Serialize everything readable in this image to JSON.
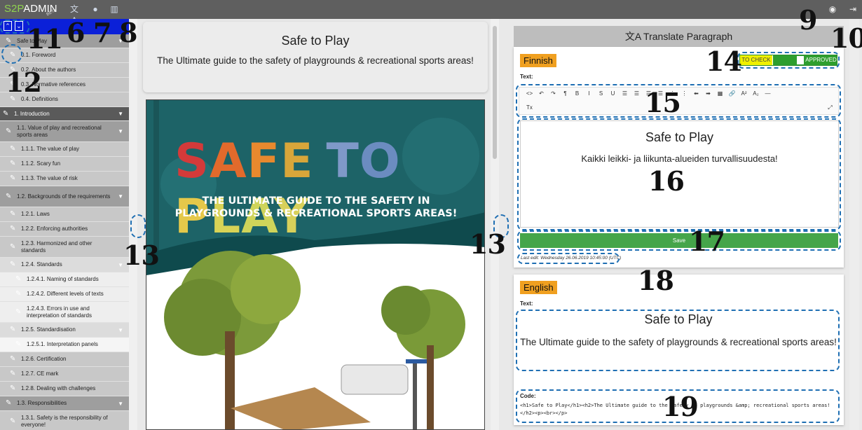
{
  "topbar": {
    "brand_s2p": "S2P",
    "brand_admin": "ADMIN",
    "brand_beta": "BETA",
    "icons": [
      "translate-icon",
      "user-icon",
      "book-icon",
      "search-icon",
      "logout-icon"
    ]
  },
  "callouts": {
    "n6": "6",
    "n7": "7",
    "n8": "8",
    "n9": "9",
    "n10": "10",
    "n11": "11",
    "n12": "12",
    "n13": "13",
    "n14": "14",
    "n15": "15",
    "n16": "16",
    "n17": "17",
    "n18": "18",
    "n19": "19"
  },
  "sidebar": {
    "items": [
      {
        "label": "Safe to Play",
        "level": 1
      },
      {
        "label": "0.1. Foreword",
        "level": 2
      },
      {
        "label": "0.2. About the authors",
        "level": 2
      },
      {
        "label": "0.3. Normative references",
        "level": 2
      },
      {
        "label": "0.4. Definitions",
        "level": 2
      },
      {
        "label": "1. Introduction",
        "level": 0
      },
      {
        "label": "1.1. Value of play and recreational sports areas",
        "level": 1
      },
      {
        "label": "1.1.1. The value of play",
        "level": 2
      },
      {
        "label": "1.1.2. Scary fun",
        "level": 2
      },
      {
        "label": "1.1.3. The value of risk",
        "level": 2
      },
      {
        "label": "1.2. Backgrounds of the requirements",
        "level": 1
      },
      {
        "label": "1.2.1. Laws",
        "level": 2
      },
      {
        "label": "1.2.2. Enforcing authorities",
        "level": 2
      },
      {
        "label": "1.2.3. Harmonized and other standards",
        "level": 2
      },
      {
        "label": "1.2.4. Standards",
        "level": 3
      },
      {
        "label": "1.2.4.1. Naming of standards",
        "level": 4
      },
      {
        "label": "1.2.4.2. Different levels of texts",
        "level": 4
      },
      {
        "label": "1.2.4.3. Errors in use and interpretation of standards",
        "level": 4
      },
      {
        "label": "1.2.5. Standardisation",
        "level": 3
      },
      {
        "label": "1.2.5.1. Interpretation panels",
        "level": 4
      },
      {
        "label": "1.2.6. Certification",
        "level": 2
      },
      {
        "label": "1.2.7. CE mark",
        "level": 2
      },
      {
        "label": "1.2.8. Dealing with challenges",
        "level": 2
      },
      {
        "label": "1.3. Responsibilities",
        "level": 1
      },
      {
        "label": "1.3.1. Safety is the responsibility of everyone!",
        "level": 2
      }
    ]
  },
  "middle": {
    "title": "Safe to Play",
    "subtitle": "The Ultimate guide to the safety of playgrounds & recreational sports areas!",
    "cover_title_letters": [
      "S",
      "A",
      "F",
      "E",
      " ",
      "T",
      "O",
      " ",
      "P",
      "L",
      "A",
      "Y"
    ],
    "cover_title_colors": [
      "#d43a3a",
      "#e26a2c",
      "#e8892e",
      "#d8a63a",
      "",
      "#7f99c8",
      "#6b8cc0",
      "",
      "#e5c84a",
      "#d8d356",
      "#cfd45a",
      "#d8d05a"
    ],
    "cover_sub_line1": "THE ULTIMATE GUIDE TO THE SAFETY IN",
    "cover_sub_line2": "PLAYGROUNDS & RECREATIONAL SPORTS AREAS!"
  },
  "panel": {
    "header": "Translate Paragraph",
    "finnish": {
      "lang": "Finnish",
      "text_label": "Text:",
      "toggle_left": "TO CHECK",
      "toggle_right": "APPROVED",
      "heading": "Safe to Play",
      "paragraph": "Kaikki leikki- ja liikunta-alueiden turvallisuudesta!",
      "save": "Save",
      "last_edit": "Last edit: Wednesday 26.06.2019 10:45:00 (UTC)"
    },
    "english": {
      "lang": "English",
      "text_label": "Text:",
      "heading": "Safe to Play",
      "paragraph": "The Ultimate guide to the safety of playgrounds & recreational sports areas!",
      "code_label": "Code:",
      "code": "<h1>Safe to Play</h1><h2>The Ultimate guide to the safety of playgrounds &amp; recreational sports areas!</h2><p><br></p>"
    },
    "toolbar_row1": [
      "<>",
      "↶",
      "↷",
      "¶",
      "B",
      "I",
      "S",
      "U",
      "☰",
      "☰",
      "☰",
      "☰",
      "⋮",
      "⋮",
      "⬅",
      "➡",
      "▦",
      "🔗",
      "A²",
      "A₂",
      "—"
    ],
    "toolbar_row2": [
      "Tx",
      "⤢"
    ]
  }
}
